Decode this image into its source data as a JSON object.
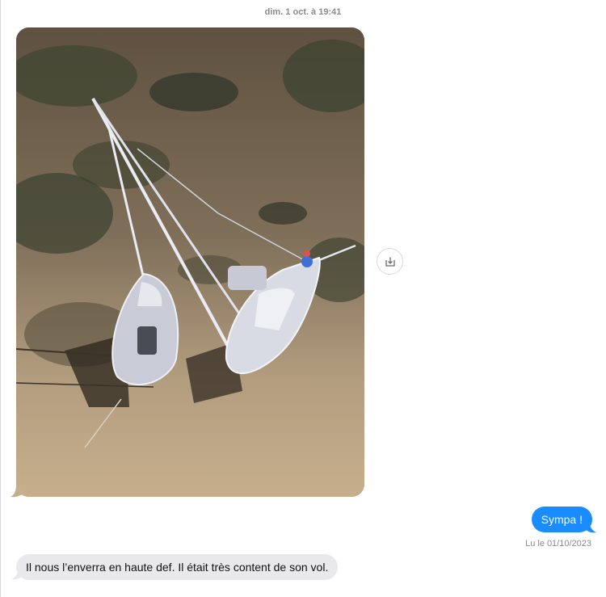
{
  "conversation": {
    "timestamp": {
      "date": "dim. 1 oct.",
      "time": "à 19:41"
    },
    "messages": [
      {
        "direction": "received",
        "type": "image",
        "alt": ""
      },
      {
        "direction": "sent",
        "type": "text",
        "text": "Sympa !"
      },
      {
        "direction": "received",
        "type": "text",
        "text": "Il nous l’enverra en haute def. Il était très content de son vol."
      }
    ],
    "read_receipt": {
      "label": "Lu le",
      "date": "01/10/2023"
    }
  },
  "actions": {
    "save_icon": "download-tray-icon"
  },
  "colors": {
    "sent_bubble": "#1b8cff",
    "received_bubble": "#e9e9eb",
    "meta_text": "#8a8a8f"
  }
}
